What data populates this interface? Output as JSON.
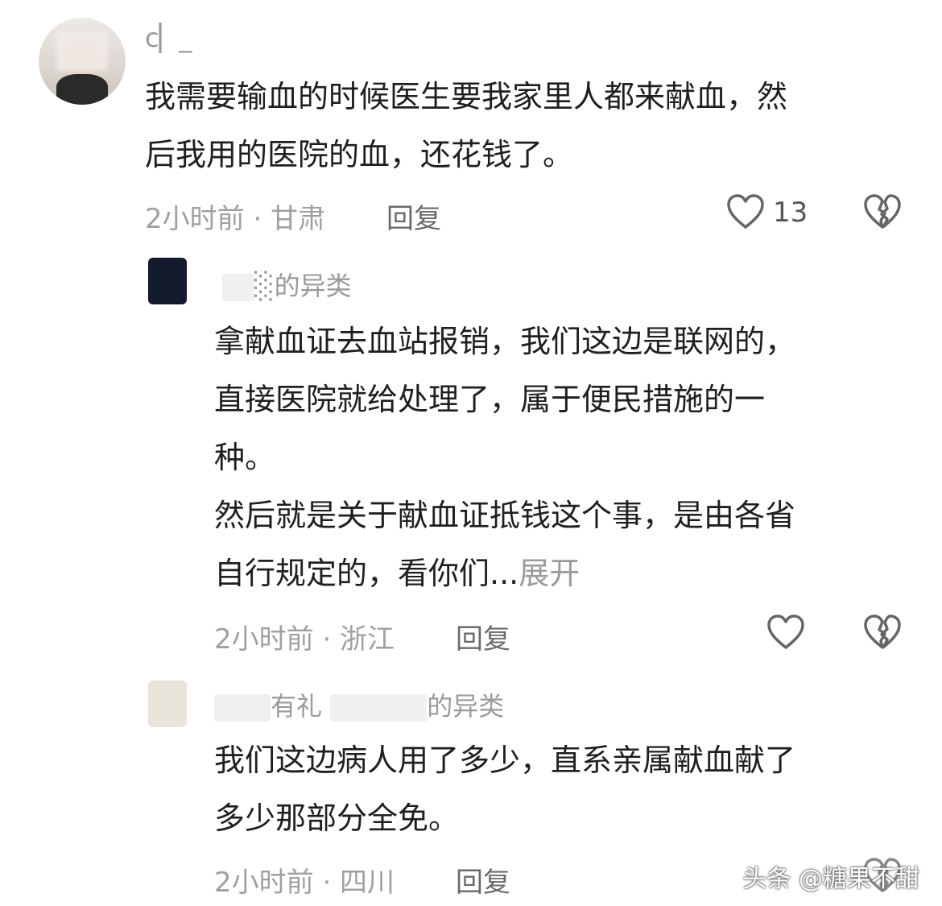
{
  "comments": [
    {
      "username": "c▏_",
      "lines": [
        "我需要输血的时候医生要我家里人都来献血，然",
        "后我用的医院的血，还花钱了。"
      ],
      "meta": "2小时前 · 甘肃",
      "reply_label": "回复",
      "likes": "13"
    },
    {
      "username": "░的异类",
      "lines": [
        "拿献血证去血站报销，我们这边是联网的，",
        "直接医院就给处理了，属于便民措施的一",
        "种。",
        "然后就是关于献血证抵钱这个事，是由各省",
        "自行规定的，看你们..."
      ],
      "expand_label": "展开",
      "meta": "2小时前 · 浙江",
      "reply_label": "回复"
    },
    {
      "username": "有礼",
      "username_tail": "的异类",
      "lines": [
        "我们这边病人用了多少，直系亲属献血献了",
        "多少那部分全免。"
      ],
      "meta": "2小时前 · 四川",
      "reply_label": "回复"
    }
  ],
  "watermark": "头条 @糖果不甜",
  "icons": [
    "heart-icon",
    "broken-heart-icon"
  ],
  "colors": {
    "text": "#1f1f1f",
    "meta": "#a0a0a0",
    "reply": "#6a6a6a",
    "background": "#ffffff"
  }
}
